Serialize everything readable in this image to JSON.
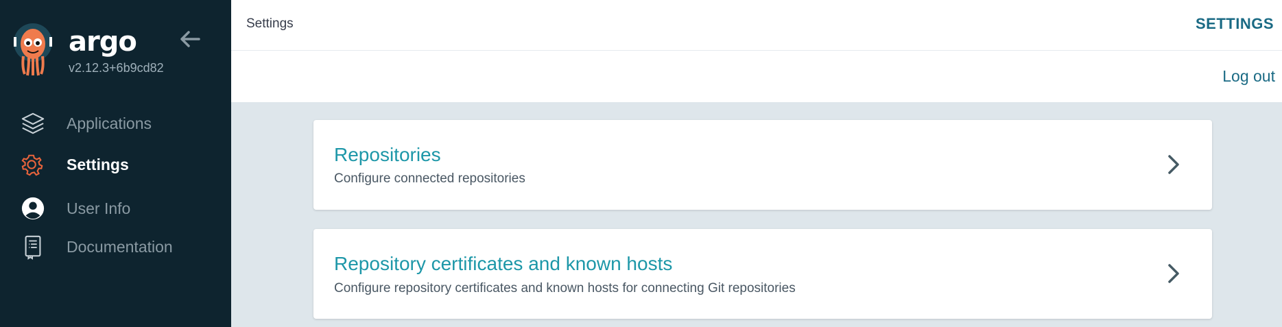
{
  "app": {
    "logo_text": "argo",
    "version": "v2.12.3+6b9cd82"
  },
  "sidebar": {
    "items": [
      {
        "label": "Applications",
        "icon": "layers-icon",
        "active": false
      },
      {
        "label": "Settings",
        "icon": "gear-icon",
        "active": true
      },
      {
        "label": "User Info",
        "icon": "user-circle-icon",
        "active": false
      },
      {
        "label": "Documentation",
        "icon": "book-icon",
        "active": false
      }
    ]
  },
  "header": {
    "breadcrumb": "Settings",
    "title": "SETTINGS",
    "logout_label": "Log out"
  },
  "cards": [
    {
      "title": "Repositories",
      "description": "Configure connected repositories"
    },
    {
      "title": "Repository certificates and known hosts",
      "description": "Configure repository certificates and known hosts for connecting Git repositories"
    }
  ],
  "colors": {
    "sidebar_bg": "#0e242f",
    "accent": "#1d97a8",
    "active_icon": "#e9643c",
    "link": "#1a6a84"
  }
}
